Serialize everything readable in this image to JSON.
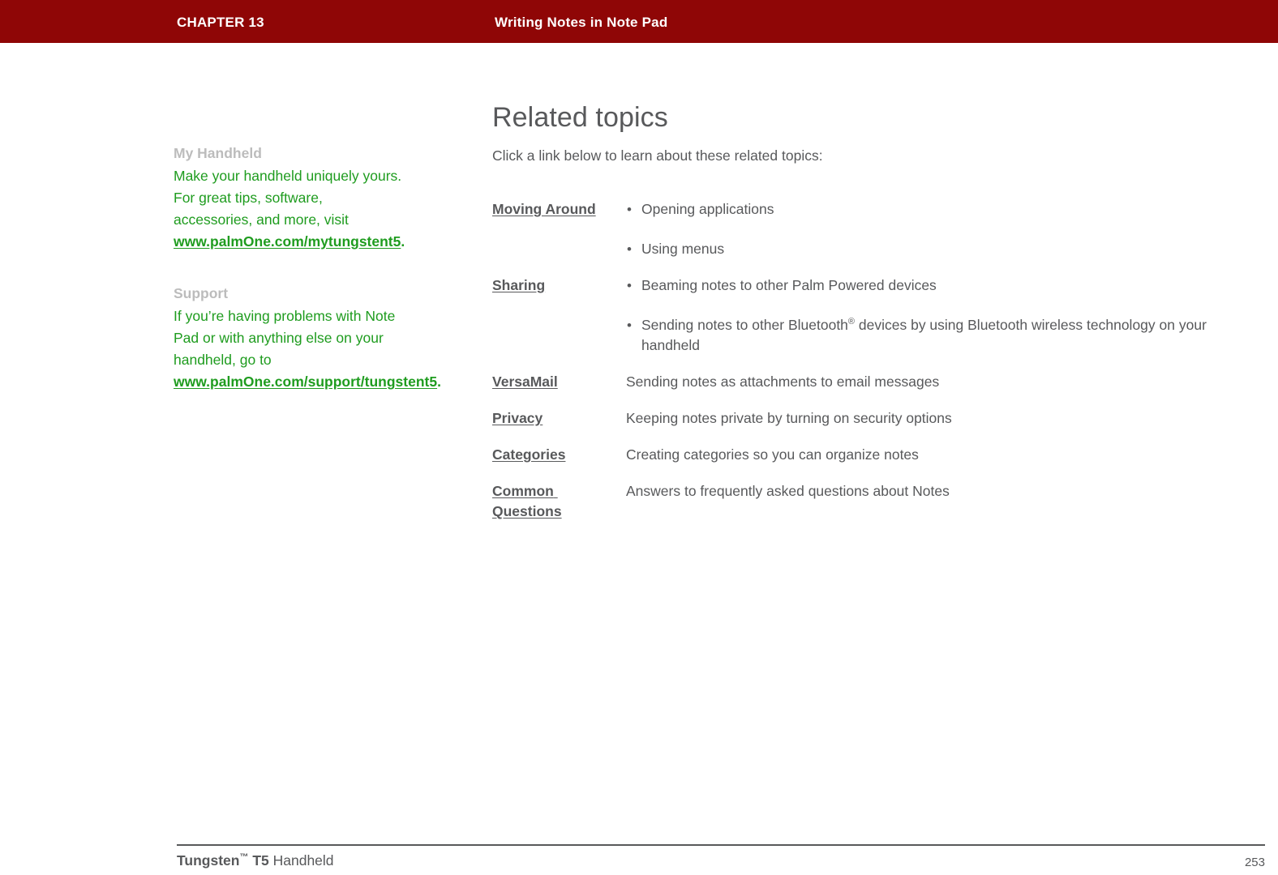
{
  "header": {
    "chapter_label": "CHAPTER 13",
    "chapter_title": "Writing Notes in Note Pad",
    "background_color": "#8f0606",
    "text_color": "#ffffff"
  },
  "sidebar": {
    "blocks": [
      {
        "heading": "My Handheld",
        "body_before": "Make your handheld uniquely yours. For great tips, software, accessories, and more, visit ",
        "link_text": "www.palmOne.com/mytungstent5",
        "body_after": "."
      },
      {
        "heading": "Support",
        "body_before": "If you’re having problems with Note Pad or with anything else on your handheld, go to ",
        "link_text": "www.palmOne.com/support/tungstent5",
        "body_after": "."
      }
    ],
    "heading_color": "#bcbcbc",
    "text_color": "#1f9c1f"
  },
  "main": {
    "title": "Related topics",
    "intro": "Click a link below to learn about these related topics:",
    "text_color": "#58595b",
    "rows": [
      {
        "link": "Moving Around",
        "bullets": [
          "Opening applications",
          "Using menus"
        ],
        "description": null
      },
      {
        "link": "Sharing",
        "bullets": [
          "Beaming notes to other Palm Powered devices",
          "Sending notes to other Bluetooth® devices by using Bluetooth wireless technology on your handheld"
        ],
        "description": null
      },
      {
        "link": "VersaMail",
        "bullets": null,
        "description": "Sending notes as attachments to email messages"
      },
      {
        "link": "Privacy",
        "bullets": null,
        "description": "Keeping notes private by turning on security options"
      },
      {
        "link": "Categories",
        "bullets": null,
        "description": "Creating categories so you can organize notes"
      },
      {
        "link": "Common Questions",
        "bullets": null,
        "description": "Answers to frequently asked questions about Notes"
      }
    ]
  },
  "footer": {
    "product_bold": "Tungsten",
    "product_tm": "™",
    "product_model": " T5",
    "product_suffix": " Handheld",
    "page_number": "253",
    "rule_color": "#58595b"
  }
}
